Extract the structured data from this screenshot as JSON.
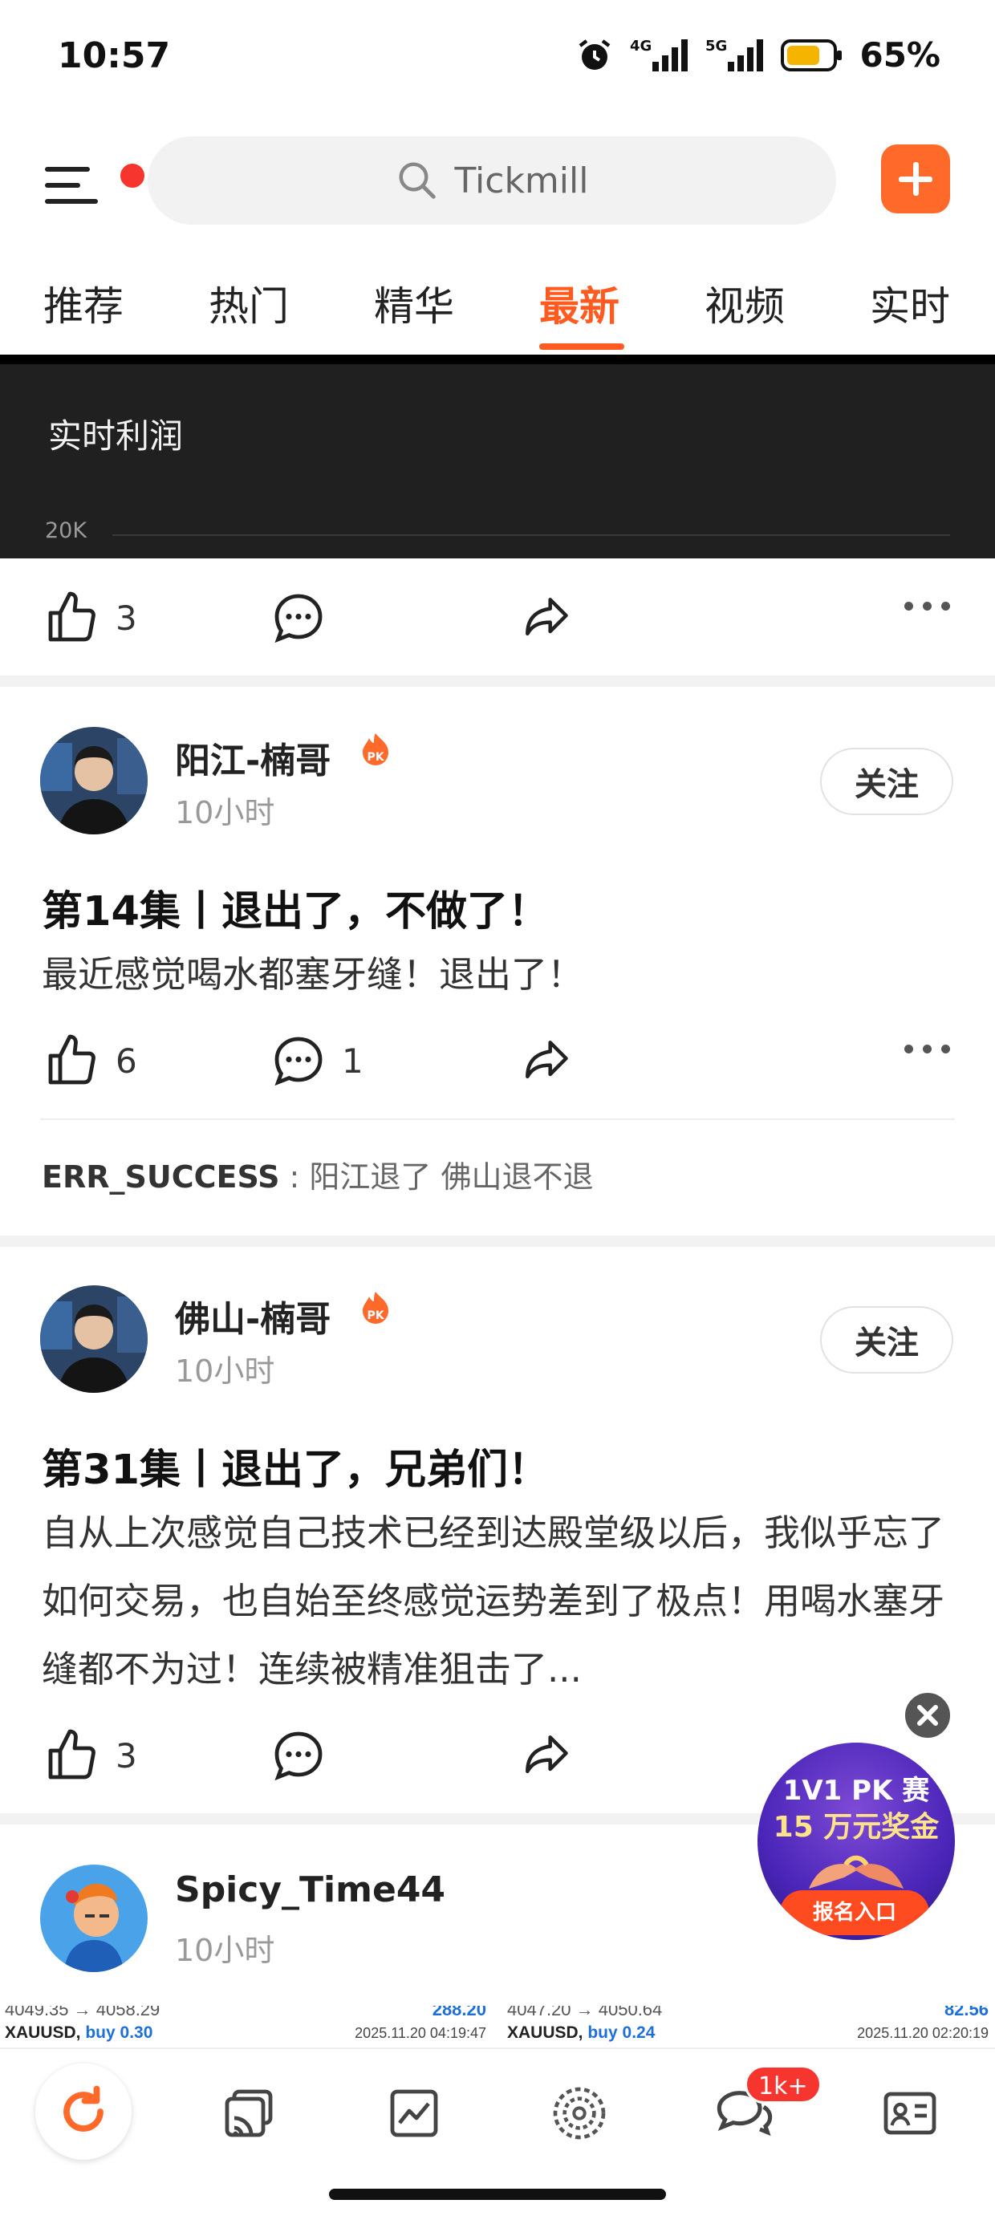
{
  "status": {
    "time": "10:57",
    "battery": "65%",
    "net1": "4G",
    "net2": "5G"
  },
  "search": {
    "placeholder": "Tickmill"
  },
  "tabs": [
    "推荐",
    "热门",
    "精华",
    "最新",
    "视频",
    "实时"
  ],
  "active_tab": "最新",
  "chart_card": {
    "title": "实时利润",
    "axis_label": "20K"
  },
  "prev_post": {
    "likes": "3"
  },
  "posts": [
    {
      "author": "阳江-楠哥",
      "time": "10小时",
      "follow": "关注",
      "title": "第14集丨退出了，不做了！",
      "body": "最近感觉喝水都塞牙缝！退出了！",
      "likes": "6",
      "comments": "1",
      "top_comment_user": "ERR_SUCCESS",
      "top_comment_text": " : 阳江退了 佛山退不退"
    },
    {
      "author": "佛山-楠哥",
      "time": "10小时",
      "follow": "关注",
      "title": "第31集丨退出了，兄弟们！",
      "body": "自从上次感觉自己技术已经到达殿堂级以后，我似乎忘了如何交易，也自始至终感觉运势差到了极点！用喝水塞牙缝都不为过！连续被精准狙击了...",
      "likes": "3"
    },
    {
      "author": "Spicy_Time44",
      "time": "10小时"
    }
  ],
  "promo": {
    "line1": "1V1 PK 赛",
    "line2": "15 万元奖金",
    "button": "报名入口"
  },
  "trades": [
    {
      "range": "4049.35 → 4058.29",
      "pnl": "288.20",
      "symbol": "XAUUSD,",
      "side": "buy 0.30",
      "date": "2025.11.20 04:19:47"
    },
    {
      "range": "4047.20 → 4050.64",
      "pnl": "82.56",
      "symbol": "XAUUSD,",
      "side": "buy 0.24",
      "date": "2025.11.20 02:20:19"
    }
  ],
  "nav": {
    "message_badge": "1k+"
  },
  "colors": {
    "accent": "#ff5a1f",
    "add_button": "#ff6a2b",
    "badge": "#f5352e"
  }
}
